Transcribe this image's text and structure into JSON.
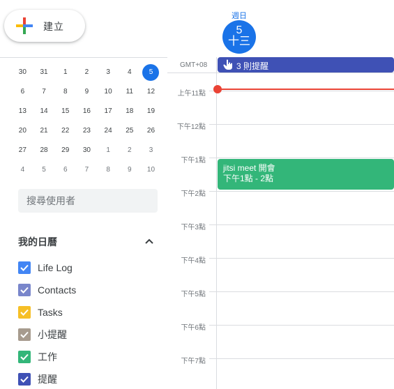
{
  "create": {
    "label": "建立"
  },
  "mini_calendar": {
    "weeks": [
      [
        {
          "d": "30",
          "muted": false
        },
        {
          "d": "31",
          "muted": false
        },
        {
          "d": "1",
          "muted": false
        },
        {
          "d": "2",
          "muted": false
        },
        {
          "d": "3",
          "muted": false
        },
        {
          "d": "4",
          "muted": false
        },
        {
          "d": "5",
          "muted": false,
          "today": true
        }
      ],
      [
        {
          "d": "6"
        },
        {
          "d": "7"
        },
        {
          "d": "8"
        },
        {
          "d": "9"
        },
        {
          "d": "10"
        },
        {
          "d": "11"
        },
        {
          "d": "12"
        }
      ],
      [
        {
          "d": "13"
        },
        {
          "d": "14"
        },
        {
          "d": "15"
        },
        {
          "d": "16"
        },
        {
          "d": "17"
        },
        {
          "d": "18"
        },
        {
          "d": "19"
        }
      ],
      [
        {
          "d": "20"
        },
        {
          "d": "21"
        },
        {
          "d": "22"
        },
        {
          "d": "23"
        },
        {
          "d": "24"
        },
        {
          "d": "25"
        },
        {
          "d": "26"
        }
      ],
      [
        {
          "d": "27"
        },
        {
          "d": "28"
        },
        {
          "d": "29"
        },
        {
          "d": "30"
        },
        {
          "d": "1",
          "muted": true
        },
        {
          "d": "2",
          "muted": true
        },
        {
          "d": "3",
          "muted": true
        }
      ],
      [
        {
          "d": "4",
          "muted": true
        },
        {
          "d": "5",
          "muted": true
        },
        {
          "d": "6",
          "muted": true
        },
        {
          "d": "7",
          "muted": true
        },
        {
          "d": "8",
          "muted": true
        },
        {
          "d": "9",
          "muted": true
        },
        {
          "d": "10",
          "muted": true
        }
      ]
    ]
  },
  "search_users": {
    "placeholder": "搜尋使用者"
  },
  "my_calendars": {
    "title": "我的日曆",
    "items": [
      {
        "label": "Life Log",
        "color": "#4285f4"
      },
      {
        "label": "Contacts",
        "color": "#7986cb"
      },
      {
        "label": "Tasks",
        "color": "#f6bf26"
      },
      {
        "label": "小提醒",
        "color": "#a79b8e"
      },
      {
        "label": "工作",
        "color": "#33b679"
      },
      {
        "label": "提醒",
        "color": "#3f51b5"
      }
    ]
  },
  "day_header": {
    "day_name": "週日",
    "date": "5",
    "lunar": "十三"
  },
  "timezone": "GMT+08",
  "allday_event": {
    "label": "3 則提醒",
    "color": "#3f51b5"
  },
  "time_labels": [
    "上午11點",
    "下午12點",
    "下午1點",
    "下午2點",
    "下午3點",
    "下午4點",
    "下午5點",
    "下午6點",
    "下午7點"
  ],
  "event": {
    "title": "jitsi meet 開會",
    "time": "下午1點 - 2點",
    "color": "#33b679"
  },
  "colors": {
    "accent": "#1a73e8",
    "now_line": "#ea4335"
  }
}
